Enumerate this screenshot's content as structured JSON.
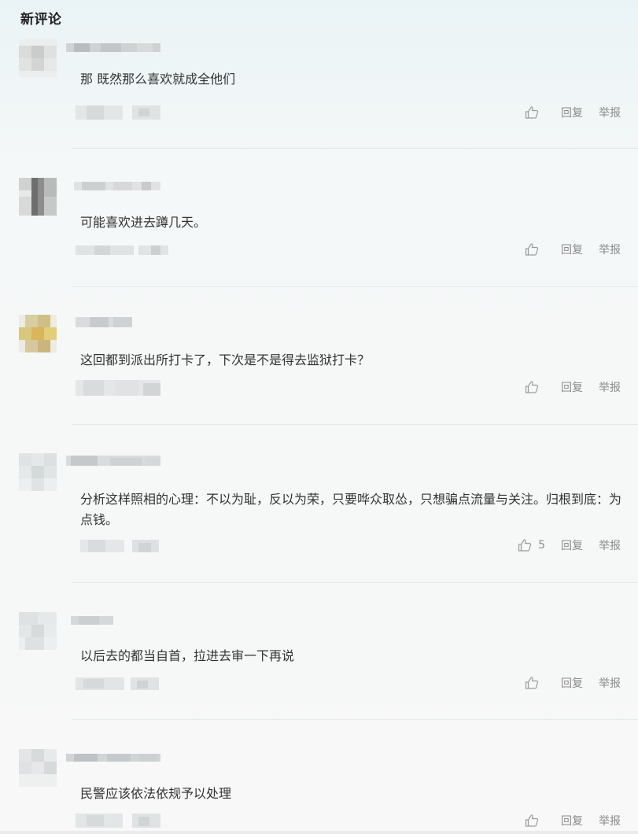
{
  "section": {
    "title": "新评论"
  },
  "icons": {
    "like": "thumbs-up-icon",
    "avatar": "pixelated-avatar-image",
    "username": "pixelated-username",
    "meta": "pixelated-meta-info"
  },
  "colors": {
    "text": "#333333",
    "muted": "#8a8a8a",
    "divider": "#e6e9ea"
  },
  "comments": [
    {
      "text": "那 既然那么喜欢就成全他们",
      "like_count": "",
      "reply_label": "回复",
      "report_label": "举报"
    },
    {
      "text": "可能喜欢进去蹲几天。",
      "like_count": "",
      "reply_label": "回复",
      "report_label": "举报"
    },
    {
      "text": "这回都到派出所打卡了，下次是不是得去监狱打卡？",
      "like_count": "",
      "reply_label": "回复",
      "report_label": "举报"
    },
    {
      "text": "分析这样照相的心理：不以为耻，反以为荣，只要哗众取怂，只想骗点流量与关注。归根到底：为点钱。",
      "like_count": "5",
      "reply_label": "回复",
      "report_label": "举报"
    },
    {
      "text": "以后去的都当自首，拉进去审一下再说",
      "like_count": "",
      "reply_label": "回复",
      "report_label": "举报"
    },
    {
      "text": "民警应该依法依规予以处理",
      "like_count": "",
      "reply_label": "回复",
      "report_label": "举报"
    }
  ]
}
